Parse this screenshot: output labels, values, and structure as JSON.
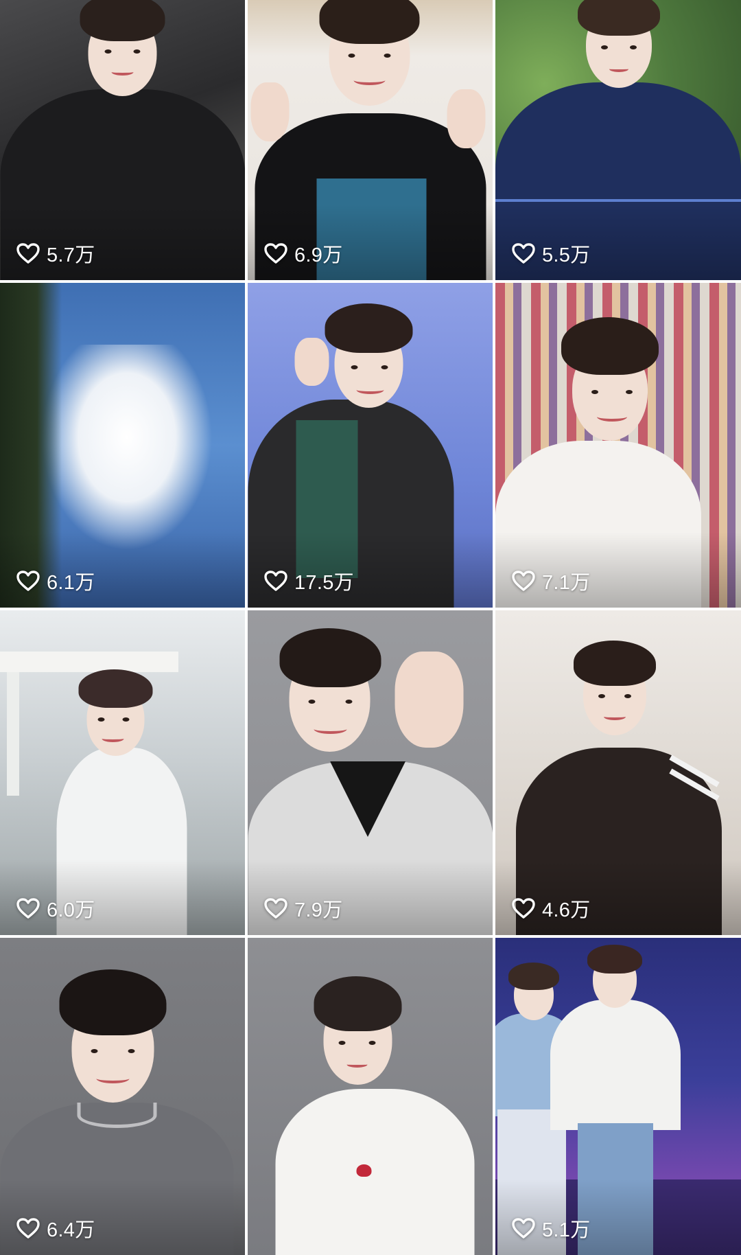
{
  "grid": {
    "items": [
      {
        "likes": "5.7万",
        "icon": "heart-outline-icon"
      },
      {
        "likes": "6.9万",
        "icon": "heart-outline-icon"
      },
      {
        "likes": "5.5万",
        "icon": "heart-outline-icon"
      },
      {
        "likes": "6.1万",
        "icon": "heart-outline-icon"
      },
      {
        "likes": "17.5万",
        "icon": "heart-outline-icon"
      },
      {
        "likes": "7.1万",
        "icon": "heart-outline-icon"
      },
      {
        "likes": "6.0万",
        "icon": "heart-outline-icon"
      },
      {
        "likes": "7.9万",
        "icon": "heart-outline-icon"
      },
      {
        "likes": "4.6万",
        "icon": "heart-outline-icon"
      },
      {
        "likes": "6.4万",
        "icon": "heart-outline-icon"
      },
      {
        "likes": "5.1万",
        "icon": "heart-outline-icon"
      }
    ],
    "photo_colors": {
      "dark_room": "#2b2b2d",
      "white_wall": "#e7e3de",
      "greenery": "#4f7a3e",
      "sky_blue": "#3f6fb3",
      "event_backdrop": "#6f86d8",
      "shelf_room": "#b8b2ab",
      "park_grey": "#c9cfd2",
      "grey_studio": "#8a8b8f",
      "white_room": "#dcd6cf",
      "stage_purple": "#4a3a8f"
    }
  }
}
